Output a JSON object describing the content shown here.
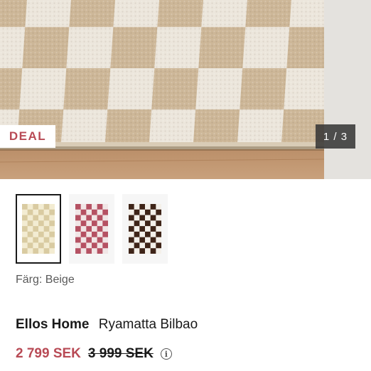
{
  "hero": {
    "badge": "DEAL",
    "pager": "1 / 3"
  },
  "thumbnails": [
    {
      "label": "Beige",
      "light": "#f3ecd2",
      "dark": "#d9cba1",
      "selected": true
    },
    {
      "label": "Rosa",
      "light": "#f1e6e6",
      "dark": "#b55263",
      "selected": false
    },
    {
      "label": "Brun",
      "light": "#f4f0ea",
      "dark": "#3e2418",
      "selected": false
    }
  ],
  "colors": {
    "accent": "#b84a55",
    "rug_light": "#ece6dc",
    "rug_dark": "#cbb596",
    "floor": "#c49a74"
  },
  "product": {
    "color_label": "Färg: Beige",
    "brand": "Ellos Home",
    "name": "Ryamatta Bilbao",
    "price_now": "2 799 SEK",
    "price_old": "3 999 SEK",
    "info_icon": "info-icon"
  }
}
